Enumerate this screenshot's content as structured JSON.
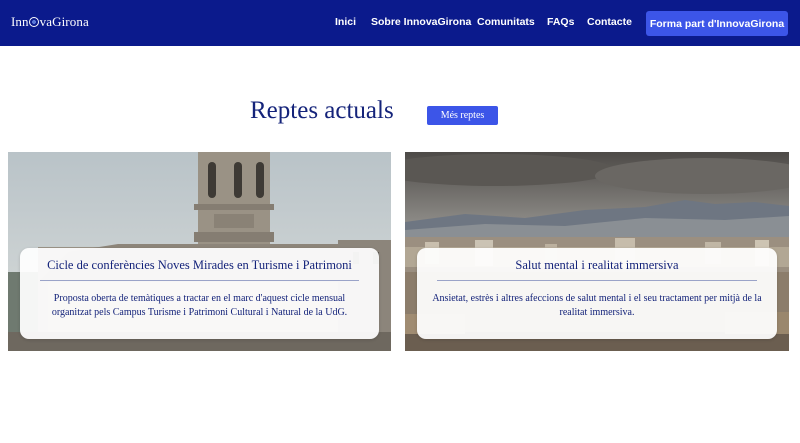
{
  "nav": {
    "logo_before": "Inn",
    "logo_after": "vaGirona",
    "links": [
      "Inici",
      "Sobre InnovaGirona",
      "Comunitats",
      "FAQs",
      "Contacte"
    ],
    "cta_label": "Forma part d'InnovaGirona"
  },
  "main": {
    "title": "Reptes actuals",
    "more_button": "Més reptes"
  },
  "cards": [
    {
      "title": "Cicle de conferències Noves Mirades en Turisme i Patrimoni",
      "description": "Proposta oberta de temàtiques a tractar en el marc d'aquest cicle mensual organitzat pels Campus Turisme i Patrimoni Cultural i Natural de la UdG."
    },
    {
      "title": "Salut mental i realitat immersiva",
      "description": "Ansietat, estrès i altres afeccions de salut mental i el seu tractament per mitjà de la realitat immersiva."
    }
  ],
  "colors": {
    "nav_bg": "#0b1a8c",
    "accent": "#3c55e8",
    "heading": "#14237a"
  }
}
